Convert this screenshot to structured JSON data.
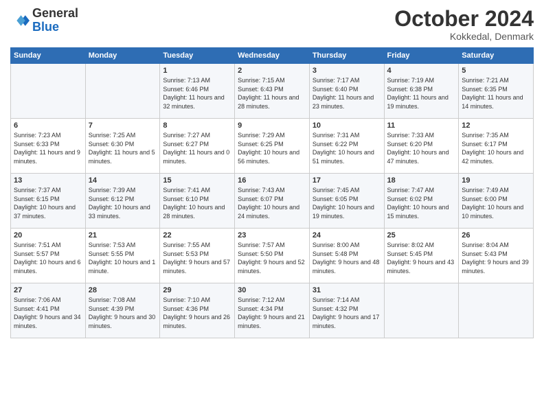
{
  "logo": {
    "text_general": "General",
    "text_blue": "Blue"
  },
  "header": {
    "month": "October 2024",
    "location": "Kokkedal, Denmark"
  },
  "days_of_week": [
    "Sunday",
    "Monday",
    "Tuesday",
    "Wednesday",
    "Thursday",
    "Friday",
    "Saturday"
  ],
  "weeks": [
    [
      {
        "day": "",
        "sunrise": "",
        "sunset": "",
        "daylight": ""
      },
      {
        "day": "",
        "sunrise": "",
        "sunset": "",
        "daylight": ""
      },
      {
        "day": "1",
        "sunrise": "Sunrise: 7:13 AM",
        "sunset": "Sunset: 6:46 PM",
        "daylight": "Daylight: 11 hours and 32 minutes."
      },
      {
        "day": "2",
        "sunrise": "Sunrise: 7:15 AM",
        "sunset": "Sunset: 6:43 PM",
        "daylight": "Daylight: 11 hours and 28 minutes."
      },
      {
        "day": "3",
        "sunrise": "Sunrise: 7:17 AM",
        "sunset": "Sunset: 6:40 PM",
        "daylight": "Daylight: 11 hours and 23 minutes."
      },
      {
        "day": "4",
        "sunrise": "Sunrise: 7:19 AM",
        "sunset": "Sunset: 6:38 PM",
        "daylight": "Daylight: 11 hours and 19 minutes."
      },
      {
        "day": "5",
        "sunrise": "Sunrise: 7:21 AM",
        "sunset": "Sunset: 6:35 PM",
        "daylight": "Daylight: 11 hours and 14 minutes."
      }
    ],
    [
      {
        "day": "6",
        "sunrise": "Sunrise: 7:23 AM",
        "sunset": "Sunset: 6:33 PM",
        "daylight": "Daylight: 11 hours and 9 minutes."
      },
      {
        "day": "7",
        "sunrise": "Sunrise: 7:25 AM",
        "sunset": "Sunset: 6:30 PM",
        "daylight": "Daylight: 11 hours and 5 minutes."
      },
      {
        "day": "8",
        "sunrise": "Sunrise: 7:27 AM",
        "sunset": "Sunset: 6:27 PM",
        "daylight": "Daylight: 11 hours and 0 minutes."
      },
      {
        "day": "9",
        "sunrise": "Sunrise: 7:29 AM",
        "sunset": "Sunset: 6:25 PM",
        "daylight": "Daylight: 10 hours and 56 minutes."
      },
      {
        "day": "10",
        "sunrise": "Sunrise: 7:31 AM",
        "sunset": "Sunset: 6:22 PM",
        "daylight": "Daylight: 10 hours and 51 minutes."
      },
      {
        "day": "11",
        "sunrise": "Sunrise: 7:33 AM",
        "sunset": "Sunset: 6:20 PM",
        "daylight": "Daylight: 10 hours and 47 minutes."
      },
      {
        "day": "12",
        "sunrise": "Sunrise: 7:35 AM",
        "sunset": "Sunset: 6:17 PM",
        "daylight": "Daylight: 10 hours and 42 minutes."
      }
    ],
    [
      {
        "day": "13",
        "sunrise": "Sunrise: 7:37 AM",
        "sunset": "Sunset: 6:15 PM",
        "daylight": "Daylight: 10 hours and 37 minutes."
      },
      {
        "day": "14",
        "sunrise": "Sunrise: 7:39 AM",
        "sunset": "Sunset: 6:12 PM",
        "daylight": "Daylight: 10 hours and 33 minutes."
      },
      {
        "day": "15",
        "sunrise": "Sunrise: 7:41 AM",
        "sunset": "Sunset: 6:10 PM",
        "daylight": "Daylight: 10 hours and 28 minutes."
      },
      {
        "day": "16",
        "sunrise": "Sunrise: 7:43 AM",
        "sunset": "Sunset: 6:07 PM",
        "daylight": "Daylight: 10 hours and 24 minutes."
      },
      {
        "day": "17",
        "sunrise": "Sunrise: 7:45 AM",
        "sunset": "Sunset: 6:05 PM",
        "daylight": "Daylight: 10 hours and 19 minutes."
      },
      {
        "day": "18",
        "sunrise": "Sunrise: 7:47 AM",
        "sunset": "Sunset: 6:02 PM",
        "daylight": "Daylight: 10 hours and 15 minutes."
      },
      {
        "day": "19",
        "sunrise": "Sunrise: 7:49 AM",
        "sunset": "Sunset: 6:00 PM",
        "daylight": "Daylight: 10 hours and 10 minutes."
      }
    ],
    [
      {
        "day": "20",
        "sunrise": "Sunrise: 7:51 AM",
        "sunset": "Sunset: 5:57 PM",
        "daylight": "Daylight: 10 hours and 6 minutes."
      },
      {
        "day": "21",
        "sunrise": "Sunrise: 7:53 AM",
        "sunset": "Sunset: 5:55 PM",
        "daylight": "Daylight: 10 hours and 1 minute."
      },
      {
        "day": "22",
        "sunrise": "Sunrise: 7:55 AM",
        "sunset": "Sunset: 5:53 PM",
        "daylight": "Daylight: 9 hours and 57 minutes."
      },
      {
        "day": "23",
        "sunrise": "Sunrise: 7:57 AM",
        "sunset": "Sunset: 5:50 PM",
        "daylight": "Daylight: 9 hours and 52 minutes."
      },
      {
        "day": "24",
        "sunrise": "Sunrise: 8:00 AM",
        "sunset": "Sunset: 5:48 PM",
        "daylight": "Daylight: 9 hours and 48 minutes."
      },
      {
        "day": "25",
        "sunrise": "Sunrise: 8:02 AM",
        "sunset": "Sunset: 5:45 PM",
        "daylight": "Daylight: 9 hours and 43 minutes."
      },
      {
        "day": "26",
        "sunrise": "Sunrise: 8:04 AM",
        "sunset": "Sunset: 5:43 PM",
        "daylight": "Daylight: 9 hours and 39 minutes."
      }
    ],
    [
      {
        "day": "27",
        "sunrise": "Sunrise: 7:06 AM",
        "sunset": "Sunset: 4:41 PM",
        "daylight": "Daylight: 9 hours and 34 minutes."
      },
      {
        "day": "28",
        "sunrise": "Sunrise: 7:08 AM",
        "sunset": "Sunset: 4:39 PM",
        "daylight": "Daylight: 9 hours and 30 minutes."
      },
      {
        "day": "29",
        "sunrise": "Sunrise: 7:10 AM",
        "sunset": "Sunset: 4:36 PM",
        "daylight": "Daylight: 9 hours and 26 minutes."
      },
      {
        "day": "30",
        "sunrise": "Sunrise: 7:12 AM",
        "sunset": "Sunset: 4:34 PM",
        "daylight": "Daylight: 9 hours and 21 minutes."
      },
      {
        "day": "31",
        "sunrise": "Sunrise: 7:14 AM",
        "sunset": "Sunset: 4:32 PM",
        "daylight": "Daylight: 9 hours and 17 minutes."
      },
      {
        "day": "",
        "sunrise": "",
        "sunset": "",
        "daylight": ""
      },
      {
        "day": "",
        "sunrise": "",
        "sunset": "",
        "daylight": ""
      }
    ]
  ]
}
